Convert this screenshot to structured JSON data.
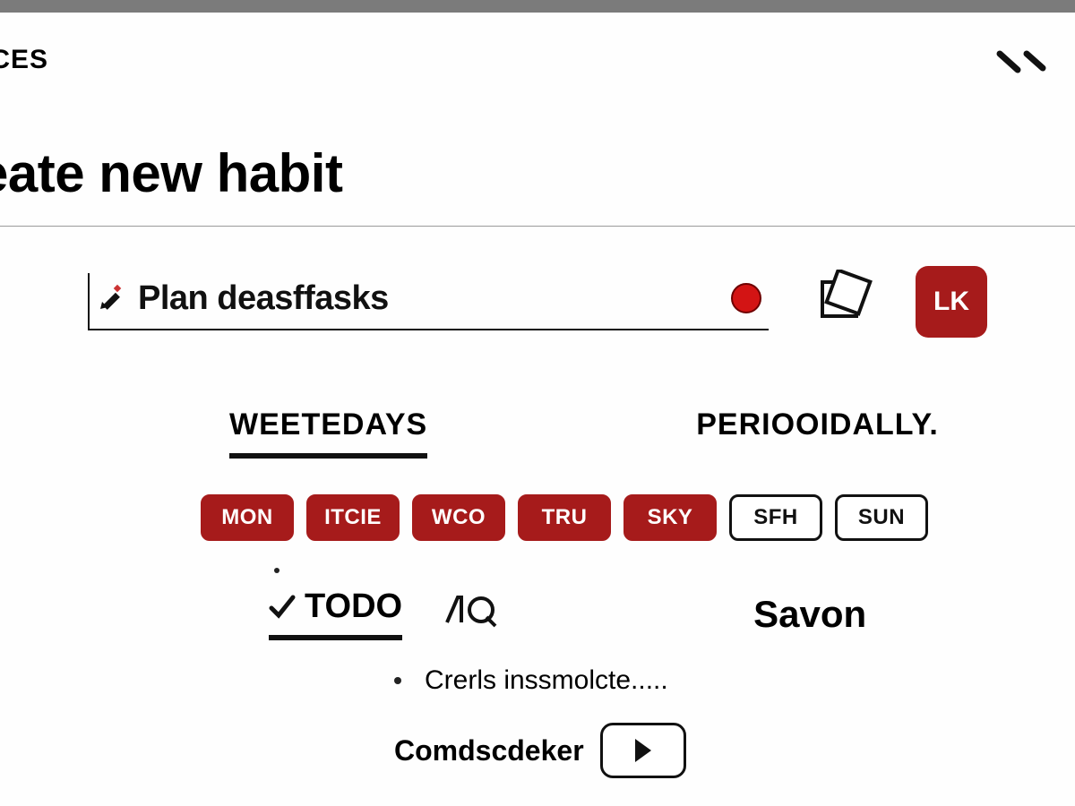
{
  "colors": {
    "accent": "#a61b1b",
    "dot": "#d31414"
  },
  "header": {
    "nav_fragment": "ICES",
    "close_icon": "close"
  },
  "page": {
    "title_fragment": "eate new habit"
  },
  "input": {
    "value": "Plan deasffasks",
    "placeholder": "",
    "ok_label": "LK"
  },
  "tabs": {
    "weekdays": "WEETEDAYS",
    "periodically": "PERIOOIDALLY."
  },
  "days": [
    {
      "label": "MON",
      "selected": true
    },
    {
      "label": "ITCIE",
      "selected": true
    },
    {
      "label": "WCO",
      "selected": true
    },
    {
      "label": "TRU",
      "selected": true
    },
    {
      "label": "SKY",
      "selected": true
    },
    {
      "label": "SFH",
      "selected": false
    },
    {
      "label": "SUN",
      "selected": false
    }
  ],
  "subopts": {
    "todo": "TODO",
    "other": "AQ",
    "save": "Savon"
  },
  "helper": "Crerls inssmolcte.....",
  "picker": {
    "label": "Comdscdeker"
  }
}
